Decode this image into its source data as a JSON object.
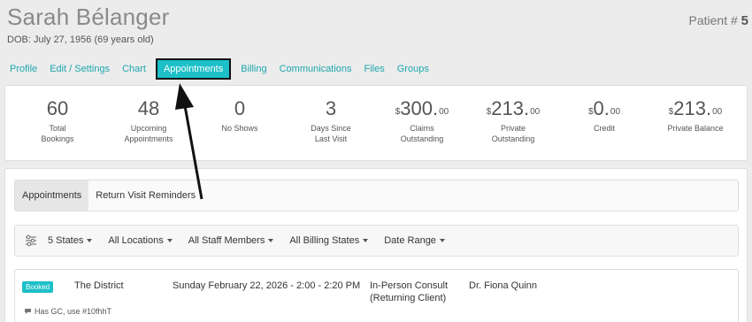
{
  "patient": {
    "name": "Sarah Bélanger",
    "dob": "DOB: July 27, 1956 (69 years old)",
    "number_label": "Patient #",
    "number": "5"
  },
  "nav": {
    "items": [
      {
        "label": "Profile"
      },
      {
        "label": "Edit / Settings"
      },
      {
        "label": "Chart"
      },
      {
        "label": "Appointments",
        "active": true
      },
      {
        "label": "Billing"
      },
      {
        "label": "Communications"
      },
      {
        "label": "Files"
      },
      {
        "label": "Groups"
      }
    ]
  },
  "stats": [
    {
      "value": "60",
      "label1": "Total",
      "label2": "Bookings"
    },
    {
      "value": "48",
      "label1": "Upcoming",
      "label2": "Appointments"
    },
    {
      "value": "0",
      "label1": "No Shows",
      "label2": ""
    },
    {
      "value": "3",
      "label1": "Days Since",
      "label2": "Last Visit"
    },
    {
      "currency": "$",
      "value": "300.",
      "cents": "00",
      "label1": "Claims",
      "label2": "Outstanding"
    },
    {
      "currency": "$",
      "value": "213.",
      "cents": "00",
      "label1": "Private",
      "label2": "Outstanding"
    },
    {
      "currency": "$",
      "value": "0.",
      "cents": "00",
      "label1": "Credit",
      "label2": ""
    },
    {
      "currency": "$",
      "value": "213.",
      "cents": "00",
      "label1": "Private Balance",
      "label2": ""
    }
  ],
  "subtabs": [
    {
      "label": "Appointments",
      "active": true
    },
    {
      "label": "Return Visit Reminders"
    }
  ],
  "filters": {
    "icon": "sliders-icon",
    "items": [
      "5 States",
      "All Locations",
      "All Staff Members",
      "All Billing States",
      "Date Range"
    ]
  },
  "appointment": {
    "status": "Booked",
    "location": "The District",
    "datetime": "Sunday February 22, 2026 - 2:00 - 2:20 PM",
    "type_line1": "In-Person Consult",
    "type_line2": "(Returning Client)",
    "provider": "Dr. Fiona Quinn",
    "note": "Has GC, use #10fhhT"
  },
  "colors": {
    "accent": "#1dbfc8",
    "link": "#1ea7ad",
    "background": "#ececec"
  }
}
